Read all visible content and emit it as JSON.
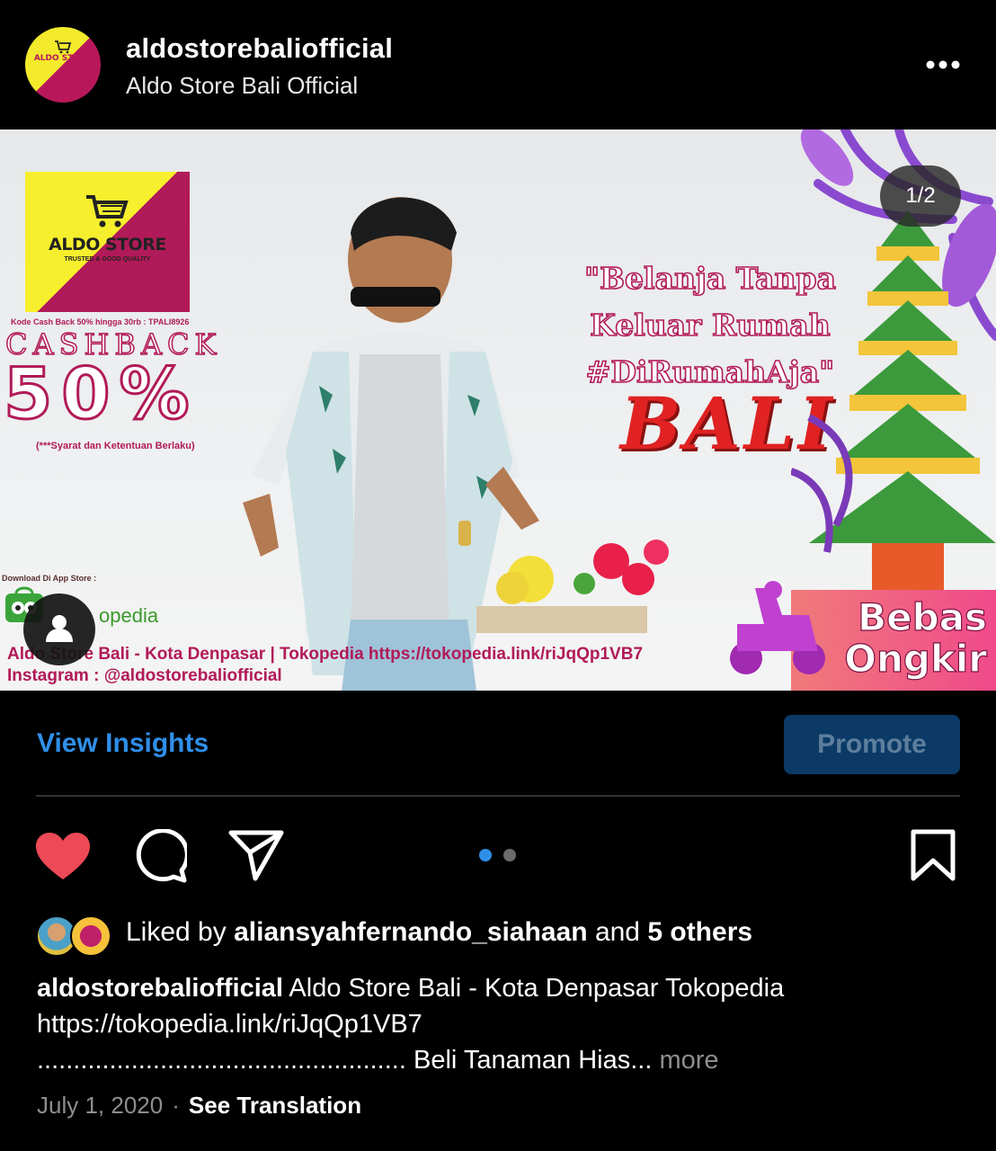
{
  "header": {
    "username": "aldostorebaliofficial",
    "display_name": "Aldo Store Bali Official"
  },
  "post": {
    "counter": "1/2",
    "banner": {
      "logo_text": "ALDO STORE",
      "logo_sub": "TRUSTED & GOOD QUALITY",
      "kode": "Kode Cash Back 50% hingga 30rb : TPALI8926",
      "cashback": "CASHBACK",
      "percent": "50%",
      "syarat": "(***Syarat dan Ketentuan Berlaku)",
      "download": "Download Di App Store :",
      "tokopedia": "opedia",
      "slogan_line1": "\"Belanja Tanpa",
      "slogan_line2": "Keluar Rumah",
      "slogan_line3": "#DiRumahAja\"",
      "bali": "BALI",
      "bebas": "Bebas",
      "ongkir": "Ongkir",
      "footer1": "Aldo Store Bali - Kota Denpasar | Tokopedia https://tokopedia.link/riJqQp1VB7",
      "footer2": "Instagram : @aldostorebaliofficial"
    }
  },
  "insights": {
    "view_label": "View Insights",
    "promote_label": "Promote"
  },
  "likes": {
    "prefix": "Liked by",
    "user": "aliansyahfernando_siahaan",
    "mid": "and",
    "others": "5 others"
  },
  "caption": {
    "username": "aldostorebaliofficial",
    "text1": "Aldo Store Bali - Kota Denpasar  Tokopedia",
    "text2": "https://tokopedia.link/riJqQp1VB7",
    "text3": "................................................... Beli Tanaman Hias...",
    "more": "more"
  },
  "meta": {
    "date": "July 1, 2020",
    "separator": "·",
    "translate": "See Translation"
  },
  "colors": {
    "link_blue": "#2f8fe8",
    "heart_red": "#ed4956",
    "brand_magenta": "#b11a58",
    "brand_yellow": "#f6ef2d"
  },
  "icons": [
    "more-icon",
    "heart-icon",
    "comment-icon",
    "share-icon",
    "bookmark-icon",
    "user-tag-icon",
    "cart-icon"
  ]
}
